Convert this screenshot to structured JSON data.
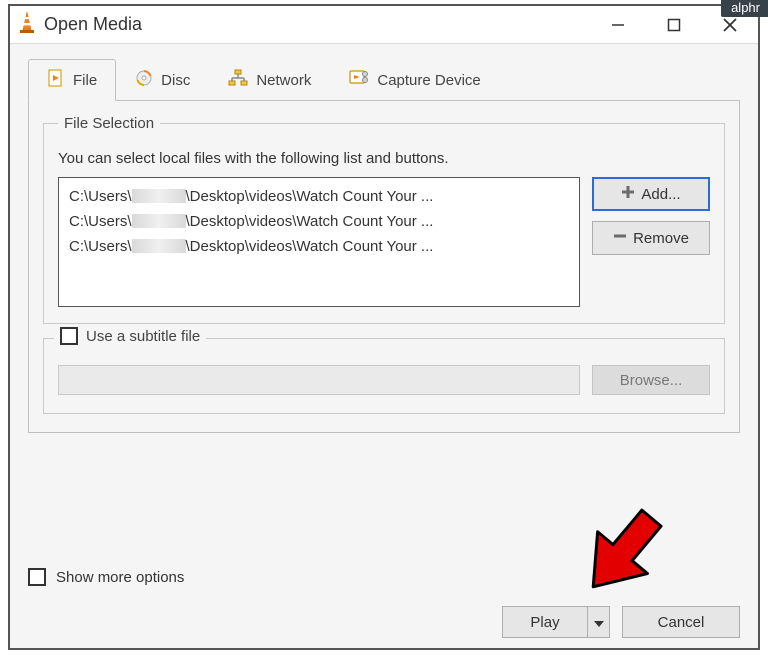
{
  "window": {
    "title": "Open Media"
  },
  "tabs": {
    "0": {
      "label": "File"
    },
    "1": {
      "label": "Disc"
    },
    "2": {
      "label": "Network"
    },
    "3": {
      "label": "Capture Device"
    }
  },
  "file_selection": {
    "legend": "File Selection",
    "desc": "You can select local files with the following list and buttons.",
    "items_prefix": "C:\\Users\\",
    "items_suffix": "\\Desktop\\videos\\Watch Count Your ...",
    "add_label": "Add...",
    "remove_label": "Remove"
  },
  "subtitle": {
    "label": "Use a subtitle file",
    "browse_label": "Browse..."
  },
  "show_more_label": "Show more options",
  "actions": {
    "play_label": "Play",
    "cancel_label": "Cancel"
  },
  "watermark": "alphr"
}
